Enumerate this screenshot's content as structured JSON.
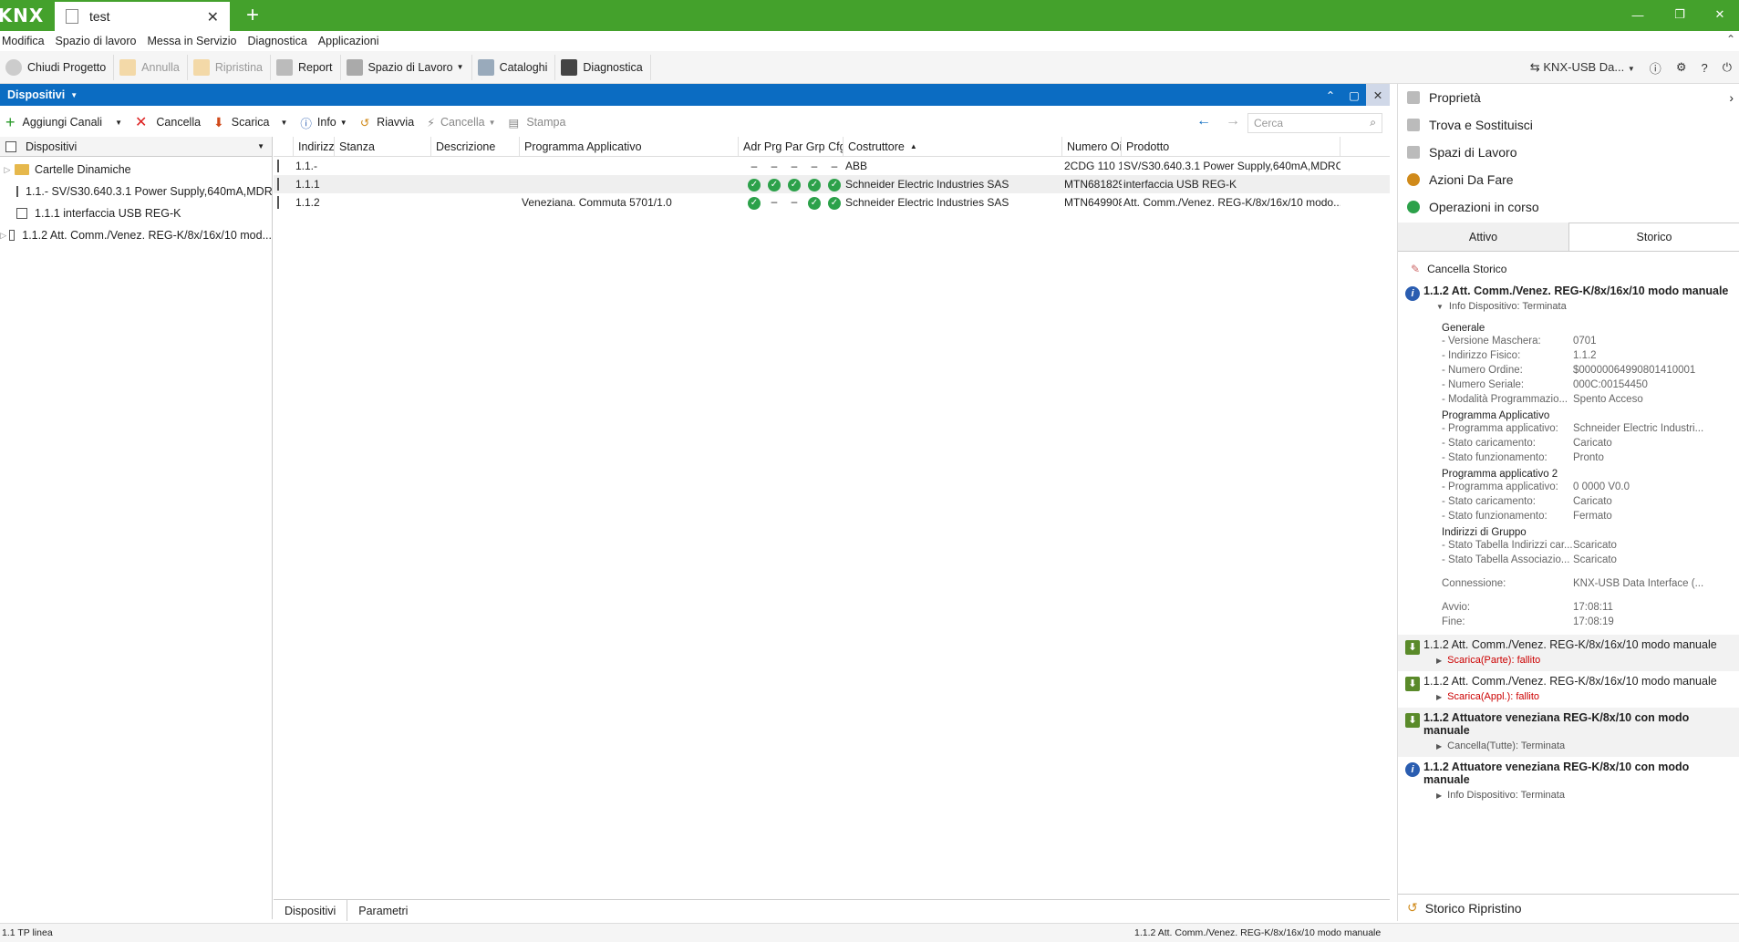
{
  "app": {
    "logo": "KNX",
    "tab_title": "test"
  },
  "menu": [
    "Modifica",
    "Spazio di lavoro",
    "Messa in Servizio",
    "Diagnostica",
    "Applicazioni"
  ],
  "toolbar": {
    "close_project": "Chiudi Progetto",
    "undo": "Annulla",
    "redo": "Ripristina",
    "report": "Report",
    "workspace": "Spazio di Lavoro",
    "catalogs": "Cataloghi",
    "diagnostics": "Diagnostica",
    "interface": "KNX-USB Da..."
  },
  "devices_panel": {
    "title": "Dispositivi",
    "toolbar": {
      "add_channels": "Aggiungi Canali",
      "delete": "Cancella",
      "download": "Scarica",
      "info": "Info",
      "restart": "Riavvia",
      "unload": "Cancella",
      "print": "Stampa",
      "search_placeholder": "Cerca"
    },
    "tree_header": "Dispositivi",
    "tree": [
      {
        "label": "Cartelle Dinamiche",
        "type": "folder"
      },
      {
        "label": "1.1.- SV/S30.640.3.1 Power Supply,640mA,MDRC",
        "type": "device"
      },
      {
        "label": "1.1.1 interfaccia USB REG-K",
        "type": "device"
      },
      {
        "label": "1.1.2 Att. Comm./Venez. REG-K/8x/16x/10 mod...",
        "type": "device"
      }
    ],
    "columns": [
      "Indirizz",
      "Stanza",
      "Descrizione",
      "Programma Applicativo",
      "Adr Prg Par Grp Cfg",
      "Costruttore",
      "Numero Oi",
      "Prodotto"
    ],
    "rows": [
      {
        "address": "1.1.-",
        "room": "",
        "description": "",
        "app_program": "",
        "status": "dash",
        "manufacturer": "ABB",
        "order": "2CDG 110 1...",
        "product": "SV/S30.640.3.1 Power Supply,640mA,MDRC"
      },
      {
        "address": "1.1.1",
        "room": "",
        "description": "",
        "app_program": "",
        "status": "ok",
        "manufacturer": "Schneider Electric Industries SAS",
        "order": "MTN681829",
        "product": "interfaccia USB REG-K"
      },
      {
        "address": "1.1.2",
        "room": "",
        "description": "",
        "app_program": "Veneziana. Commuta 5701/1.0",
        "status": "mixed",
        "manufacturer": "Schneider Electric Industries SAS",
        "order": "MTN649908",
        "product": "Att. Comm./Venez. REG-K/8x/16x/10 modo..."
      }
    ],
    "bottom_tabs": [
      "Dispositivi",
      "Parametri"
    ]
  },
  "right_panel": {
    "links": [
      "Proprietà",
      "Trova e Sostituisci",
      "Spazi di Lavoro",
      "Azioni Da Fare",
      "Operazioni in corso"
    ],
    "tabs": [
      "Attivo",
      "Storico"
    ],
    "clear_history": "Cancella Storico",
    "entries": [
      {
        "title": "1.1.2 Att. Comm./Venez. REG-K/8x/16x/10 modo manuale",
        "sub": "Info Dispositivo: Terminata",
        "err": false
      },
      {
        "title": "1.1.2 Att. Comm./Venez. REG-K/8x/16x/10 modo manuale",
        "sub": "Scarica(Parte): fallito",
        "err": true
      },
      {
        "title": "1.1.2 Att. Comm./Venez. REG-K/8x/16x/10 modo manuale",
        "sub": "Scarica(Appl.): fallito",
        "err": true
      },
      {
        "title": "1.1.2 Attuatore veneziana REG-K/8x/10 con modo manuale",
        "sub": "Cancella(Tutte): Terminata",
        "err": false
      },
      {
        "title": "1.1.2 Attuatore veneziana REG-K/8x/10 con modo manuale",
        "sub": "Info Dispositivo: Terminata",
        "err": false
      }
    ],
    "details": {
      "generale": "Generale",
      "mask_version_k": "- Versione Maschera:",
      "mask_version_v": "0701",
      "phys_addr_k": "- Indirizzo Fisico:",
      "phys_addr_v": "1.1.2",
      "order_k": "- Numero Ordine:",
      "order_v": "$00000064990801410001",
      "serial_k": "- Numero Seriale:",
      "serial_v": "000C:00154450",
      "prog_mode_k": "- Modalità Programmazio...",
      "prog_mode_v": "Spento Acceso",
      "app_prog": "Programma Applicativo",
      "app_k": "- Programma applicativo:",
      "app_v": "Schneider Electric Industri...",
      "load_k": "- Stato caricamento:",
      "load_v": "Caricato",
      "run_k": "- Stato funzionamento:",
      "run_v": "Pronto",
      "app_prog2": "Programma applicativo 2",
      "app2_k": "- Programma applicativo:",
      "app2_v": "0 0000 V0.0",
      "load2_k": "- Stato caricamento:",
      "load2_v": "Caricato",
      "run2_k": "- Stato funzionamento:",
      "run2_v": "Fermato",
      "group": "Indirizzi di Gruppo",
      "ga_table_k": "- Stato Tabella Indirizzi car...",
      "ga_table_v": "Scaricato",
      "assoc_k": "- Stato Tabella Associazio...",
      "assoc_v": "Scaricato",
      "conn_k": "Connessione:",
      "conn_v": "KNX-USB Data Interface (...",
      "start_k": "Avvio:",
      "start_v": "17:08:11",
      "end_k": "Fine:",
      "end_v": "17:08:19"
    },
    "footer": "Storico Ripristino"
  },
  "status": {
    "left": "1.1 TP linea",
    "right": "1.1.2 Att. Comm./Venez. REG-K/8x/16x/10 modo manuale"
  }
}
